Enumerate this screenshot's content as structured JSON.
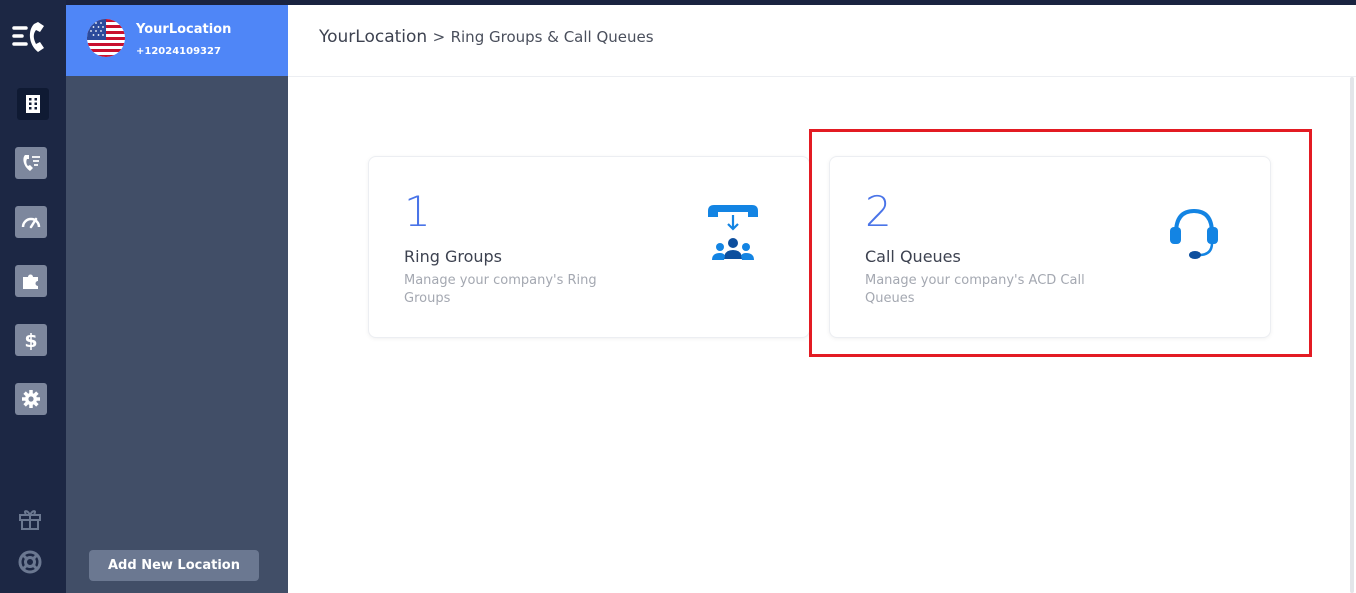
{
  "rail": {
    "items": [
      {
        "name": "locations",
        "icon": "building-icon"
      },
      {
        "name": "call-log",
        "icon": "phone-list-icon"
      },
      {
        "name": "dashboard",
        "icon": "speedometer-icon"
      },
      {
        "name": "integrations",
        "icon": "puzzle-icon"
      },
      {
        "name": "billing",
        "icon": "dollar-icon"
      },
      {
        "name": "settings",
        "icon": "gear-icon"
      }
    ],
    "bottom": [
      {
        "name": "gift",
        "icon": "gift-icon"
      },
      {
        "name": "support",
        "icon": "lifebuoy-icon"
      }
    ]
  },
  "location": {
    "name": "YourLocation",
    "phone": "+12024109327"
  },
  "sidebar": {
    "add_location_label": "Add New Location"
  },
  "breadcrumb": {
    "root": "YourLocation",
    "separator": ">",
    "current": "Ring Groups & Call Queues"
  },
  "cards": [
    {
      "count": "1",
      "title": "Ring Groups",
      "description": "Manage your company's Ring Groups",
      "icon": "ring-group-icon"
    },
    {
      "count": "2",
      "title": "Call Queues",
      "description": "Manage your company's ACD Call Queues",
      "icon": "headset-icon"
    }
  ],
  "colors": {
    "rail_bg": "#1c2744",
    "sidebar_bg": "#414e67",
    "location_card_bg": "#4f86f7",
    "accent": "#4a74e8",
    "icon_blue": "#1384e3",
    "highlight": "#e31b23"
  }
}
